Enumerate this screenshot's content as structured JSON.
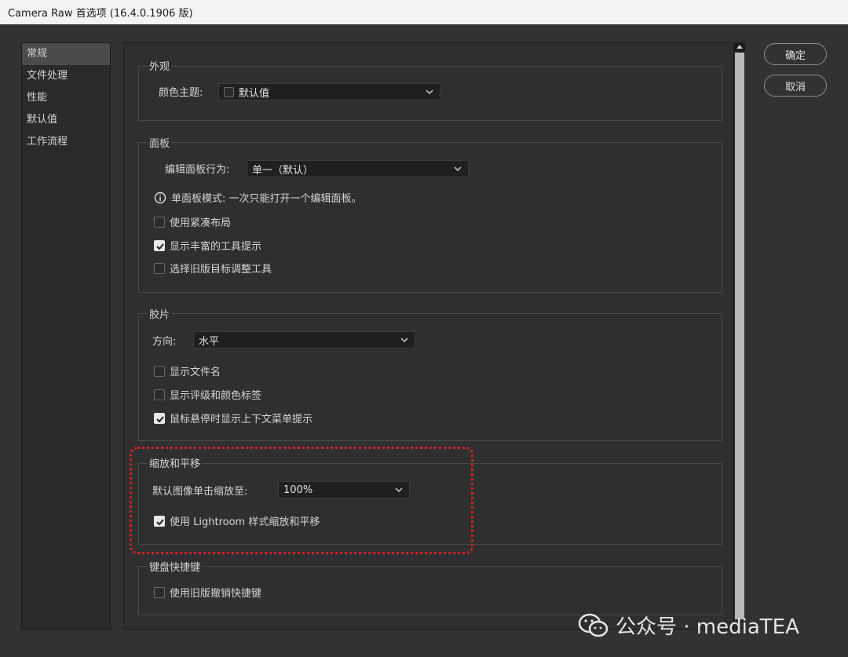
{
  "window": {
    "title": "Camera Raw 首选项 (16.4.0.1906 版)"
  },
  "sidebar": {
    "items": [
      {
        "label": "常规",
        "active": true
      },
      {
        "label": "文件处理"
      },
      {
        "label": "性能"
      },
      {
        "label": "默认值"
      },
      {
        "label": "工作流程"
      }
    ]
  },
  "buttons": {
    "ok": "确定",
    "cancel": "取消"
  },
  "appearance": {
    "title": "外观",
    "theme_label": "颜色主题:",
    "theme_value": "默认值"
  },
  "panels": {
    "title": "面板",
    "behavior_label": "编辑面板行为:",
    "behavior_value": "单一（默认）",
    "info_text": "单面板模式: 一次只能打开一个编辑面板。",
    "checkboxes": [
      {
        "label": "使用紧凑布局",
        "checked": false
      },
      {
        "label": "显示丰富的工具提示",
        "checked": true
      },
      {
        "label": "选择旧版目标调整工具",
        "checked": false
      }
    ]
  },
  "filmstrip": {
    "title": "胶片",
    "direction_label": "方向:",
    "direction_value": "水平",
    "checkboxes": [
      {
        "label": "显示文件名",
        "checked": false
      },
      {
        "label": "显示评级和颜色标签",
        "checked": false
      },
      {
        "label": "鼠标悬停时显示上下文菜单提示",
        "checked": true
      }
    ]
  },
  "zoom": {
    "title": "缩放和平移",
    "zoom_label": "默认图像单击缩放至:",
    "zoom_value": "100%",
    "checkbox": {
      "label": "使用 Lightroom 样式缩放和平移",
      "checked": true
    }
  },
  "shortcuts": {
    "title": "键盘快捷键",
    "checkbox": {
      "label": "使用旧版撤销快捷键",
      "checked": false
    }
  },
  "watermark": {
    "text": "公众号 · mediaTEA"
  },
  "colors": {
    "highlight": "#d4202a",
    "background": "#323232",
    "panel": "#2f2f2f"
  }
}
